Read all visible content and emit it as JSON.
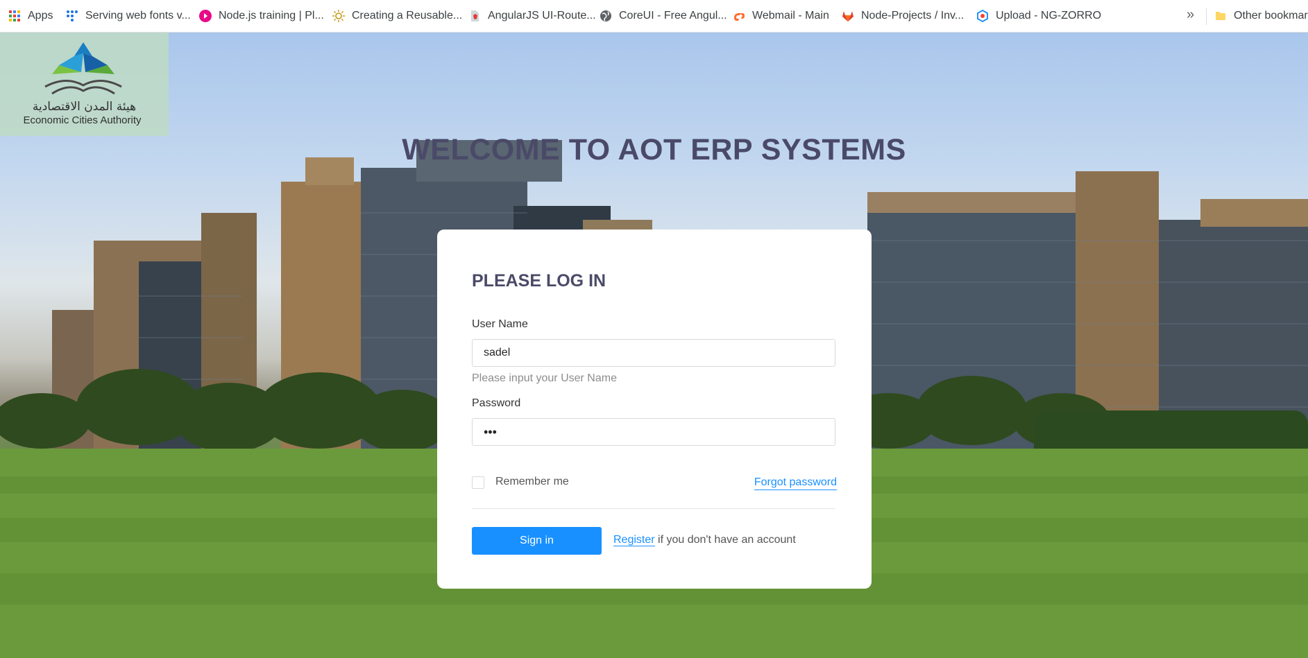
{
  "bookmarks": [
    {
      "icon": "apps-grid-icon",
      "label": "Apps",
      "color": "#e8453c"
    },
    {
      "icon": "dots-logo-icon",
      "label": "Serving web fonts v...",
      "color": "#1a73e8"
    },
    {
      "icon": "pluralsight-icon",
      "label": "Node.js training | Pl...",
      "color": "#e80a89"
    },
    {
      "icon": "sun-icon",
      "label": "Creating a Reusable...",
      "color": "#c9a227"
    },
    {
      "icon": "angular-doc-icon",
      "label": "AngularJS UI-Route...",
      "color": "#90a4ae"
    },
    {
      "icon": "globe-icon",
      "label": "CoreUI - Free Angul...",
      "color": "#5f6368"
    },
    {
      "icon": "cpanel-icon",
      "label": "Webmail - Main",
      "color": "#ff6c2c"
    },
    {
      "icon": "gitlab-icon",
      "label": "Node-Projects / Inv...",
      "color": "#e24329"
    },
    {
      "icon": "ng-zorro-icon",
      "label": "Upload - NG-ZORRO",
      "color": "#2196f3"
    }
  ],
  "more_label": "»",
  "other_bookmarks": "Other bookmarks",
  "logo": {
    "arabic": "هيئة المدن الاقتصادية",
    "english": "Economic Cities Authority"
  },
  "welcome_title": "WELCOME TO AOT ERP SYSTEMS",
  "login": {
    "title": "PLEASE LOG IN",
    "username_label": "User Name",
    "username_value": "sadel",
    "username_hint": "Please input your User Name",
    "password_label": "Password",
    "password_value": "•••",
    "remember_label": "Remember me",
    "forgot_label": "Forgot password",
    "signin_label": "Sign in",
    "register_label": "Register",
    "register_suffix": " if you don't have an account"
  },
  "colors": {
    "accent": "#1890ff",
    "title": "#4a4a68"
  }
}
